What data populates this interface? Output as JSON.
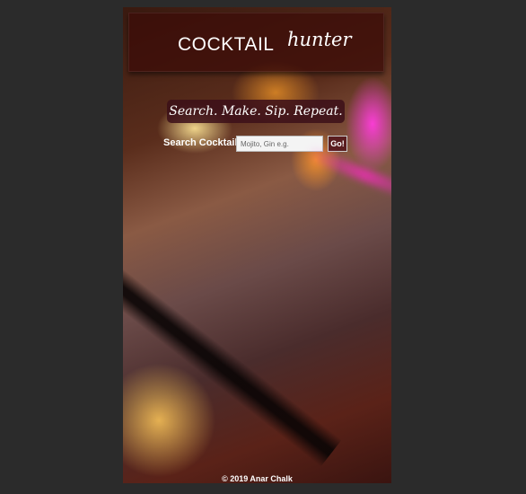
{
  "header": {
    "title_main": "COCKTAIL",
    "title_script": "hunter"
  },
  "tagline": "Search. Make. Sip. Repeat.",
  "search": {
    "label": "Search Cocktail",
    "placeholder": "Mojito, Gin e.g.",
    "value": "",
    "button_label": "Go!"
  },
  "footer": {
    "copyright": "© 2019 Anar Chalk"
  },
  "colors": {
    "page_background": "#2b2b2b",
    "header_background": "#3c0c08",
    "button_background": "#5a1e20"
  }
}
